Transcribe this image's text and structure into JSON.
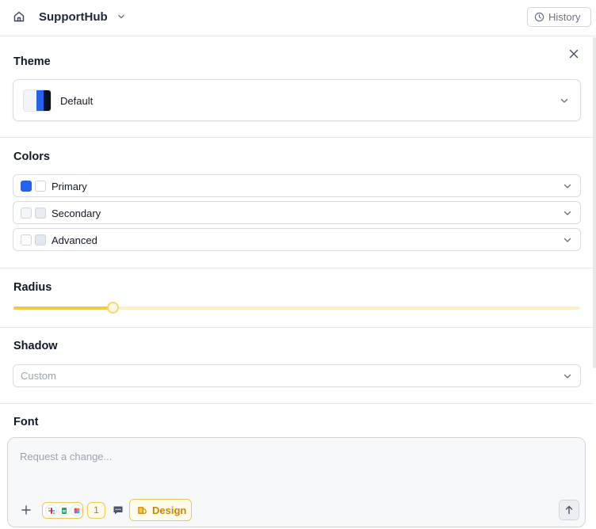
{
  "header": {
    "app_name": "SupportHub",
    "history_label": "History"
  },
  "theme": {
    "title": "Theme",
    "selected": "Default",
    "swatch_colors": [
      "#f1f5f9",
      "#2563eb",
      "#0b0f19"
    ]
  },
  "colors": {
    "title": "Colors",
    "rows": [
      {
        "label": "Primary",
        "swatches": [
          "#2563eb",
          "#ffffff"
        ]
      },
      {
        "label": "Secondary",
        "swatches": [
          "#f1f5f9",
          "#e8ecf1"
        ]
      },
      {
        "label": "Advanced",
        "swatches": [
          "#ffffff",
          "#e2e8f0"
        ]
      }
    ]
  },
  "radius": {
    "title": "Radius",
    "value_fraction": 0.175
  },
  "shadow": {
    "title": "Shadow",
    "selected": "Custom"
  },
  "font": {
    "title": "Font"
  },
  "chat": {
    "placeholder": "Request a change...",
    "badge_count": "1",
    "design_label": "Design"
  },
  "accent_color": "#f5c842",
  "icons": [
    "home-icon",
    "chevron-down-icon",
    "clock-icon",
    "close-icon",
    "plus-icon",
    "slack-icon",
    "sheets-icon",
    "figma-icon",
    "message-icon",
    "paint-icon",
    "arrow-up-icon"
  ]
}
